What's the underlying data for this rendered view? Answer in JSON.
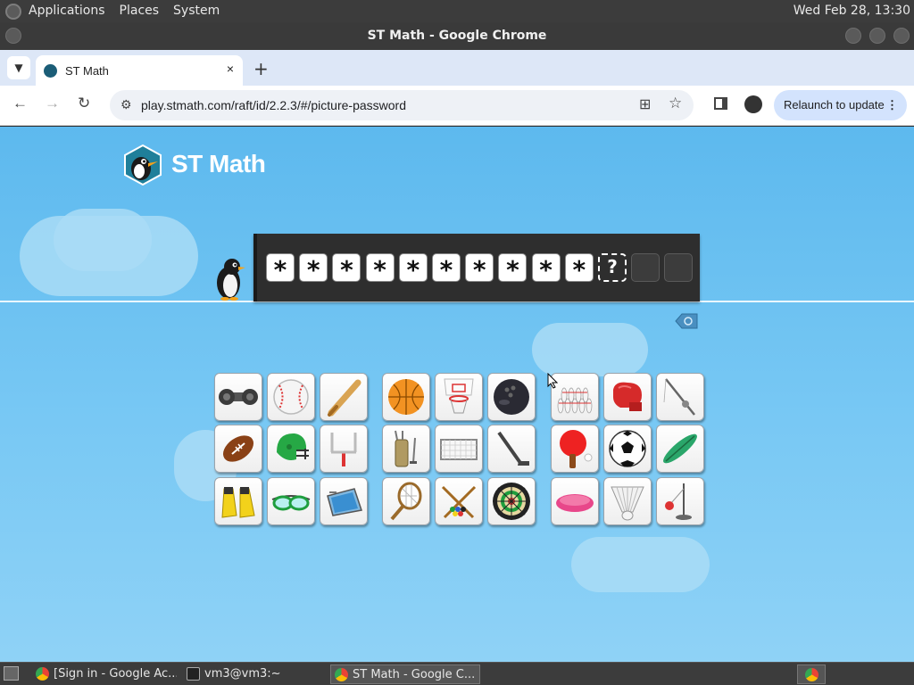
{
  "desktop": {
    "menus": [
      "Applications",
      "Places",
      "System"
    ],
    "clock": "Wed Feb 28, 13:30"
  },
  "window": {
    "title": "ST Math - Google Chrome"
  },
  "browser": {
    "tab_title": "ST Math",
    "tab_close": "×",
    "new_tab": "+",
    "url": "play.stmath.com/raft/id/2.2.3/#/picture-password",
    "relaunch_label": "Relaunch to update",
    "relaunch_menu": "⋮"
  },
  "page": {
    "brand": "ST Math",
    "password": {
      "filled_count": 10,
      "filled_char": "*",
      "current_char": "?",
      "empty_count": 2
    },
    "picture_groups": [
      {
        "name": "group-1",
        "pictures": [
          "dumbbell",
          "baseball",
          "baseball-bat",
          "football",
          "football-helmet",
          "goal-post",
          "swim-fins",
          "swim-goggles",
          "pool"
        ]
      },
      {
        "name": "group-2",
        "pictures": [
          "basketball",
          "basketball-hoop",
          "bowling-ball",
          "golf-bag",
          "soccer-goal",
          "hockey-stick",
          "tennis-racket",
          "pool-cues",
          "dartboard"
        ]
      },
      {
        "name": "group-3",
        "pictures": [
          "bowling-pins",
          "boxing-glove",
          "fishing-rod",
          "ping-pong-paddle",
          "soccer-ball",
          "surfboard",
          "frisbee",
          "shuttlecock",
          "tetherball"
        ]
      }
    ]
  },
  "taskbar": {
    "tasks": [
      {
        "label": "[Sign in - Google Ac...",
        "icon": "chrome-icon"
      },
      {
        "label": "vm3@vm3:~",
        "icon": "terminal-icon"
      },
      {
        "label": "ST Math - Google C...",
        "icon": "chrome-icon",
        "active": true
      }
    ]
  }
}
